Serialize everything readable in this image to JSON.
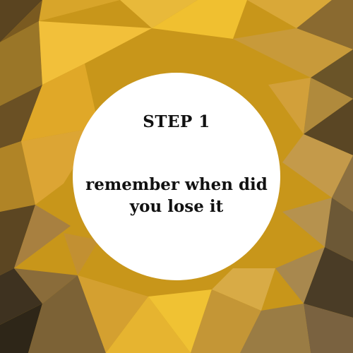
{
  "card": {
    "step_label": "STEP 1",
    "text_line_1": "remember when did",
    "text_line_2": "you lose it"
  },
  "colors": {
    "background_accent": "#c8961a",
    "circle": "#ffffff",
    "text": "#111111"
  }
}
